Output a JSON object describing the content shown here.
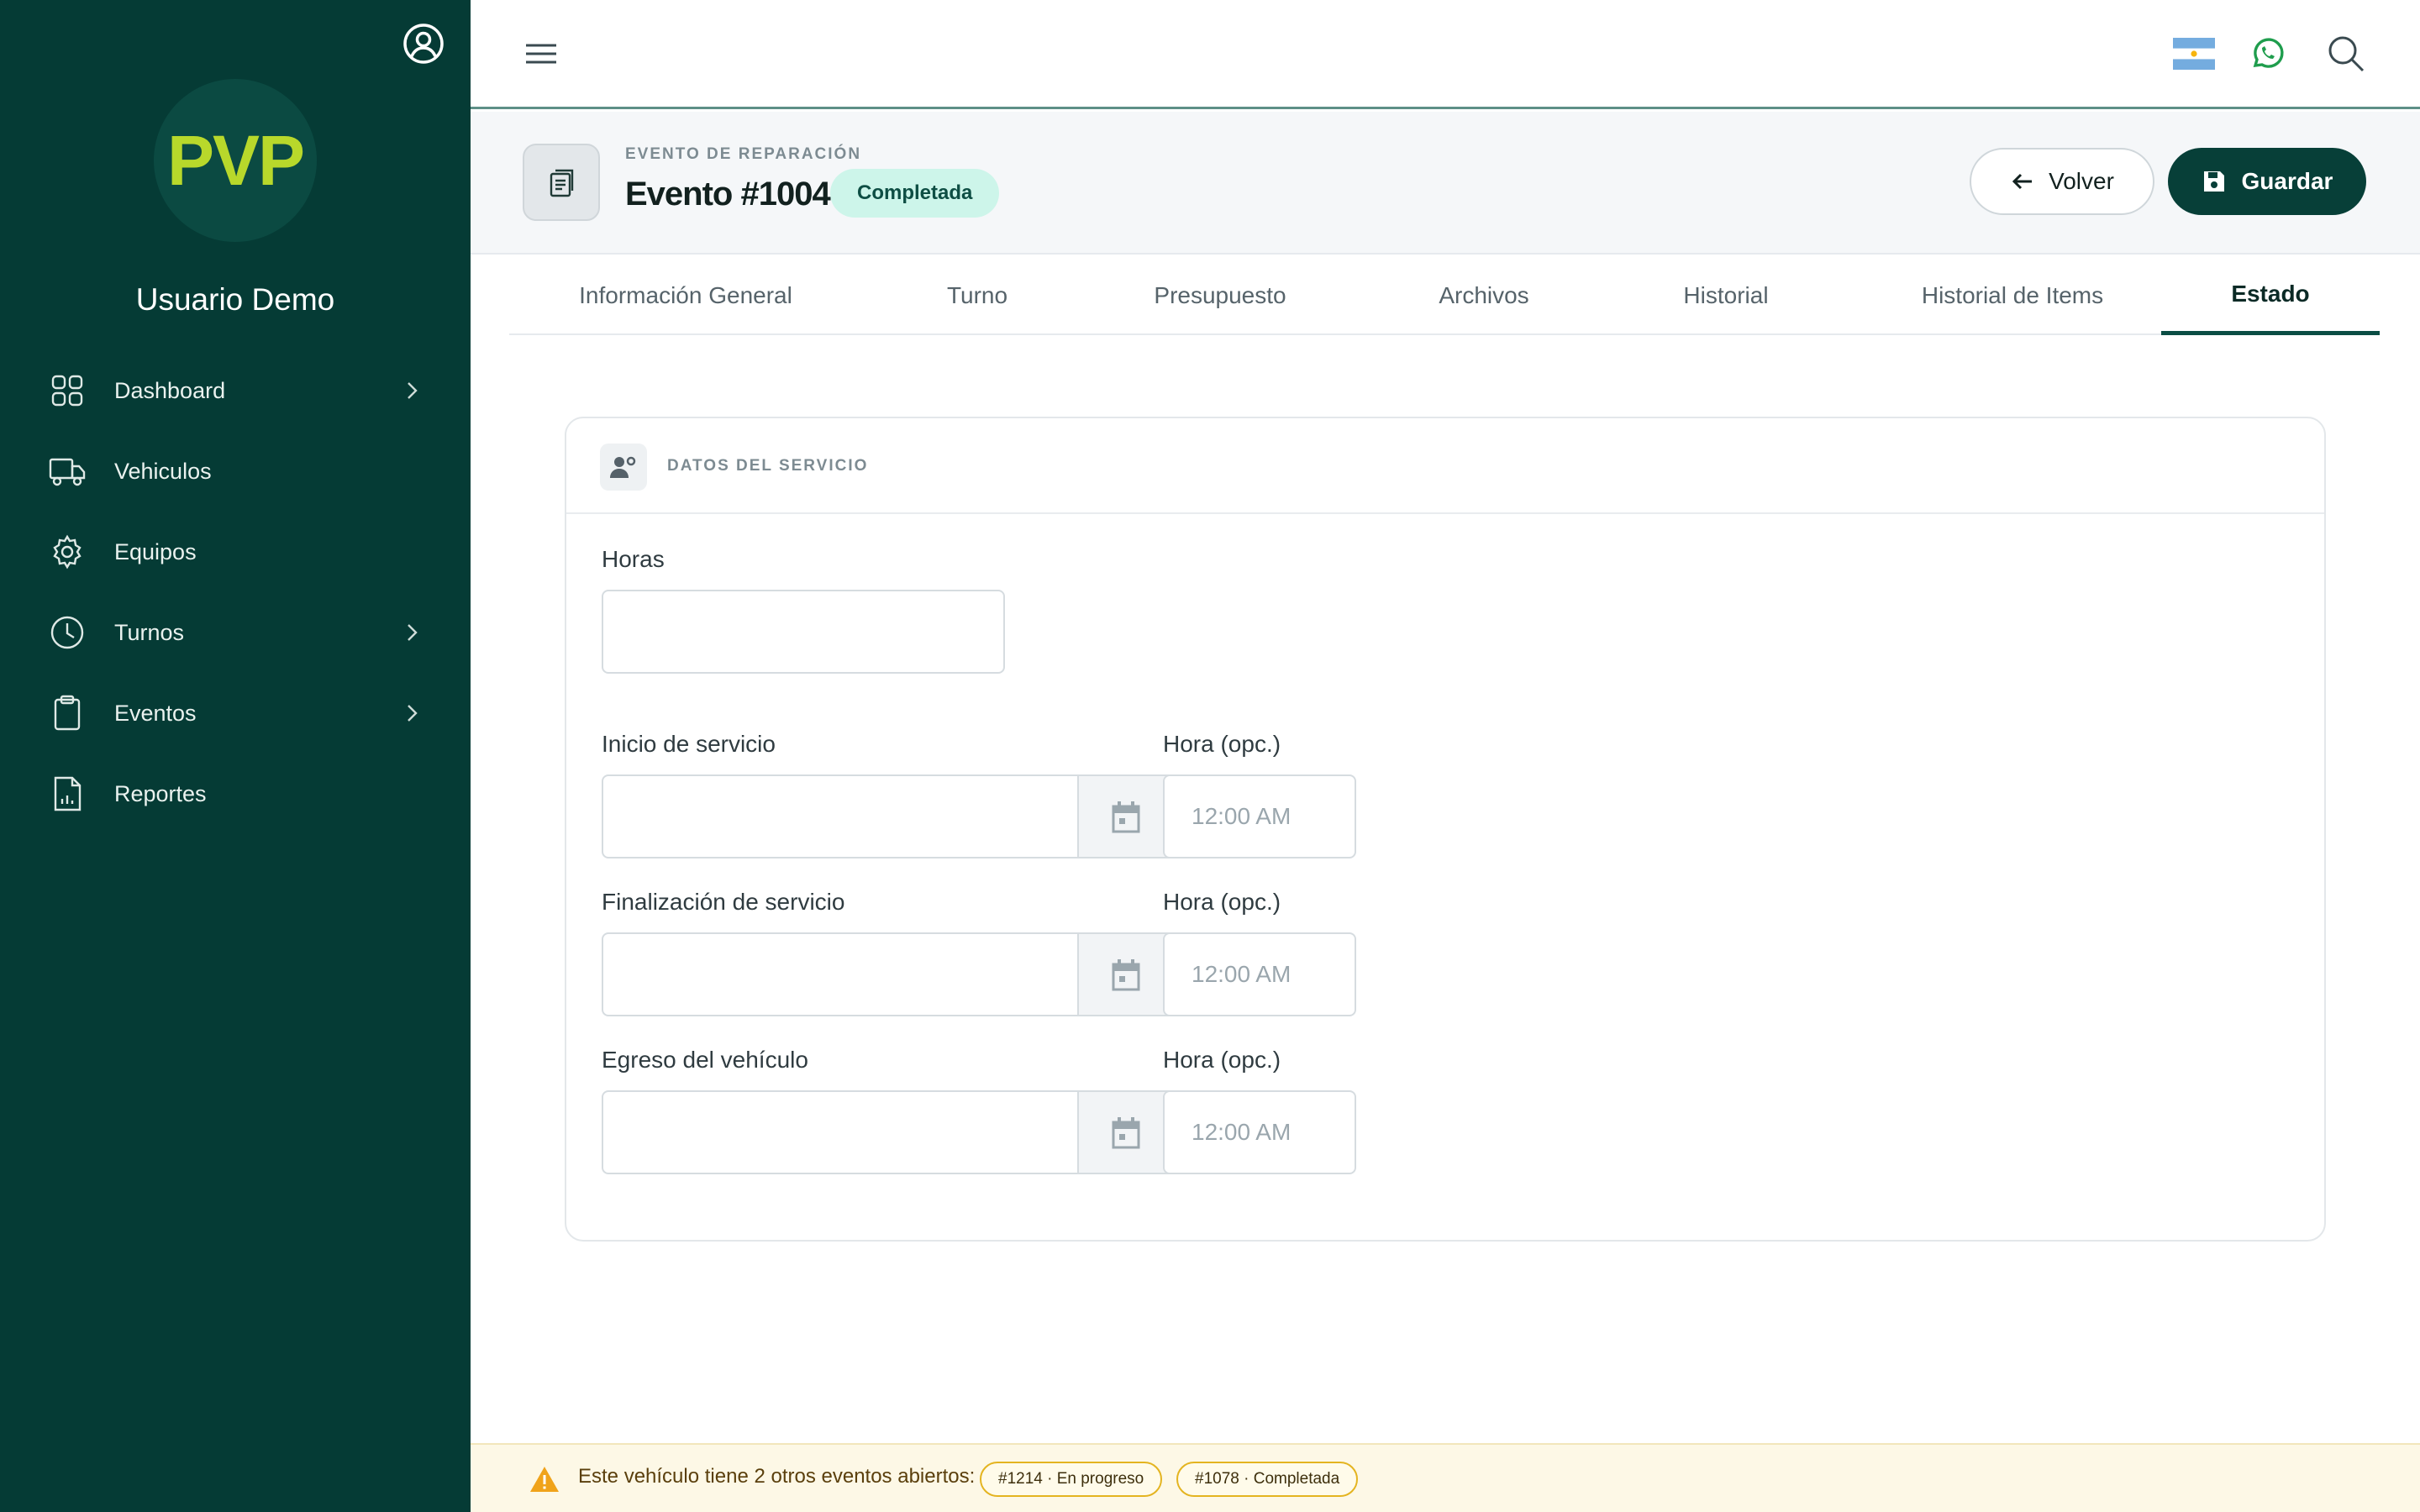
{
  "sidebar": {
    "logo_text": "PVP",
    "username": "Usuario Demo",
    "items": [
      {
        "label": "Dashboard",
        "icon": "grid-icon",
        "has_children": true
      },
      {
        "label": "Vehiculos",
        "icon": "truck-icon",
        "has_children": false
      },
      {
        "label": "Equipos",
        "icon": "gear-icon",
        "has_children": false
      },
      {
        "label": "Turnos",
        "icon": "clock-icon",
        "has_children": true
      },
      {
        "label": "Eventos",
        "icon": "clipboard-icon",
        "has_children": true
      },
      {
        "label": "Reportes",
        "icon": "report-icon",
        "has_children": false
      }
    ]
  },
  "topbar": {
    "icons": [
      "menu-icon",
      "argentina-flag-icon",
      "whatsapp-icon",
      "search-icon"
    ]
  },
  "header": {
    "eyebrow": "EVENTO DE REPARACIÓN",
    "title": "Evento #1004",
    "status": "Completada",
    "back_label": "Volver",
    "save_label": "Guardar"
  },
  "tabs": [
    {
      "label": "Información General",
      "active": false
    },
    {
      "label": "Turno",
      "active": false
    },
    {
      "label": "Presupuesto",
      "active": false
    },
    {
      "label": "Archivos",
      "active": false
    },
    {
      "label": "Historial",
      "active": false
    },
    {
      "label": "Historial de Items",
      "active": false
    },
    {
      "label": "Estado",
      "active": true
    }
  ],
  "card": {
    "title": "DATOS DEL SERVICIO",
    "hours_label": "Horas",
    "hours_value": "",
    "rows": [
      {
        "date_label": "Inicio de servicio",
        "date_value": "",
        "time_label": "Hora (opc.)",
        "time_placeholder": "12:00 AM"
      },
      {
        "date_label": "Finalización de servicio",
        "date_value": "",
        "time_label": "Hora (opc.)",
        "time_placeholder": "12:00 AM"
      },
      {
        "date_label": "Egreso del vehículo",
        "date_value": "",
        "time_label": "Hora (opc.)",
        "time_placeholder": "12:00 AM"
      }
    ]
  },
  "footer": {
    "message": "Este vehículo tiene 2 otros eventos abiertos:",
    "chips": [
      "#1214 · En progreso",
      "#1078 · Completada"
    ]
  },
  "colors": {
    "sidebar_bg": "#053b35",
    "accent": "#073f38",
    "logo": "#b8d82b",
    "badge_bg": "#cdf5ea",
    "warning": "#f0a31a"
  }
}
